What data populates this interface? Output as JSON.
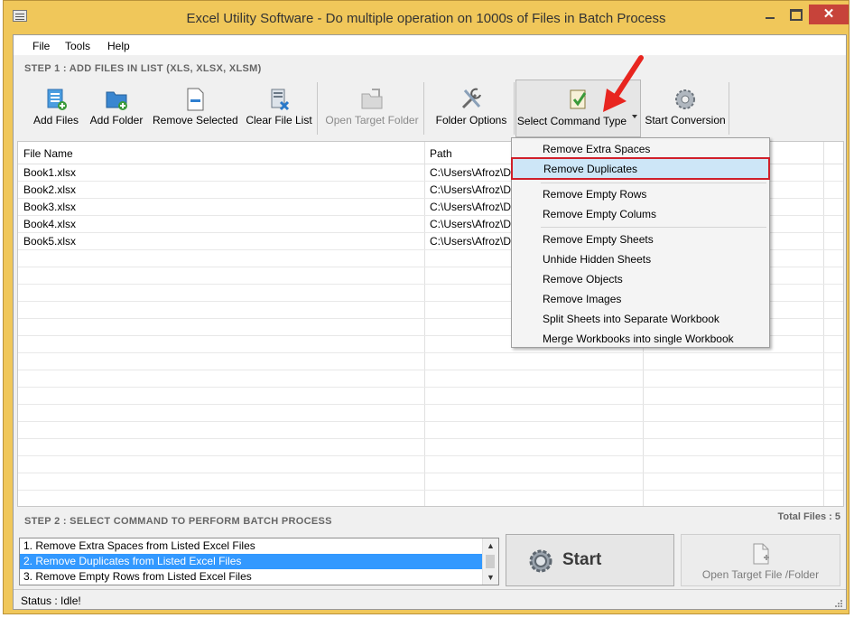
{
  "window": {
    "title": "Excel Utility Software - Do multiple operation on 1000s of Files in Batch Process",
    "close_glyph": "✕"
  },
  "menu": [
    "File",
    "Tools",
    "Help"
  ],
  "step1_label": "STEP 1 : ADD FILES IN LIST (XLS, XLSX, XLSM)",
  "toolbar": {
    "add_files": "Add Files",
    "add_folder": "Add Folder",
    "remove_selected": "Remove Selected",
    "clear_file_list": "Clear File List",
    "open_target_folder": "Open Target Folder",
    "folder_options": "Folder Options",
    "select_command_type": "Select Command Type",
    "start_conversion": "Start Conversion"
  },
  "grid": {
    "columns": [
      "File Name",
      "Path"
    ],
    "rows": [
      {
        "name": "Book1.xlsx",
        "path": "C:\\Users\\Afroz\\De"
      },
      {
        "name": "Book2.xlsx",
        "path": "C:\\Users\\Afroz\\De"
      },
      {
        "name": "Book3.xlsx",
        "path": "C:\\Users\\Afroz\\De"
      },
      {
        "name": "Book4.xlsx",
        "path": "C:\\Users\\Afroz\\De"
      },
      {
        "name": "Book5.xlsx",
        "path": "C:\\Users\\Afroz\\De"
      }
    ]
  },
  "dropdown": {
    "items": [
      "Remove Extra Spaces",
      "Remove Duplicates",
      "Remove Empty Rows",
      "Remove Empty Colums",
      "Remove Empty Sheets",
      "Unhide Hidden Sheets",
      "Remove Objects",
      "Remove Images",
      "Split Sheets into Separate Workbook",
      "Merge Workbooks into single Workbook"
    ],
    "selected_index": 1
  },
  "step2_label": "STEP 2 : SELECT COMMAND TO PERFORM BATCH PROCESS",
  "total_files": "Total Files : 5",
  "command_list": {
    "items": [
      "1. Remove Extra Spaces from Listed Excel Files",
      "2. Remove Duplicates from Listed Excel Files",
      "3. Remove Empty Rows from Listed Excel Files"
    ],
    "selected_index": 1
  },
  "start_label": "Start",
  "open_target_label": "Open Target File /Folder",
  "status_text": "Status  :  Idle!",
  "colors": {
    "frame": "#f0c75a",
    "close_button": "#c7433a",
    "selection_blue": "#3399ff",
    "highlight_red": "#d0202a",
    "menu_highlight": "#cde6f7"
  },
  "icons": [
    "app-icon",
    "add-files-icon",
    "add-folder-icon",
    "remove-selected-icon",
    "clear-file-list-icon",
    "open-target-folder-icon",
    "folder-options-icon",
    "select-command-type-icon",
    "start-conversion-icon",
    "gear-icon",
    "open-file-icon",
    "red-arrow-annotation"
  ]
}
